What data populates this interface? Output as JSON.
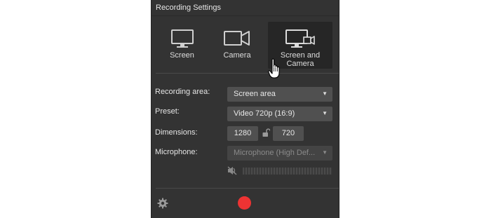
{
  "window": {
    "title": "Recording Settings"
  },
  "modes": [
    {
      "label": "Screen",
      "icon": "monitor-icon",
      "selected": false
    },
    {
      "label": "Camera",
      "icon": "video-camera-icon",
      "selected": false
    },
    {
      "label": "Screen and Camera",
      "icon": "monitor-camera-icon",
      "selected": true
    }
  ],
  "settings": {
    "recording_area": {
      "label": "Recording area:",
      "value": "Screen area"
    },
    "preset": {
      "label": "Preset:",
      "value": "Video 720p (16:9)"
    },
    "dimensions": {
      "label": "Dimensions:",
      "width": "1280",
      "height": "720",
      "locked": false
    },
    "microphone": {
      "label": "Microphone:",
      "value": "Microphone (High Def...",
      "enabled": false
    }
  },
  "footer": {
    "settings_icon": "gear-icon",
    "record_color": "#ee3333"
  },
  "colors": {
    "panel_bg": "#333333",
    "control_bg": "#505050",
    "active_mode_bg": "#262626"
  }
}
